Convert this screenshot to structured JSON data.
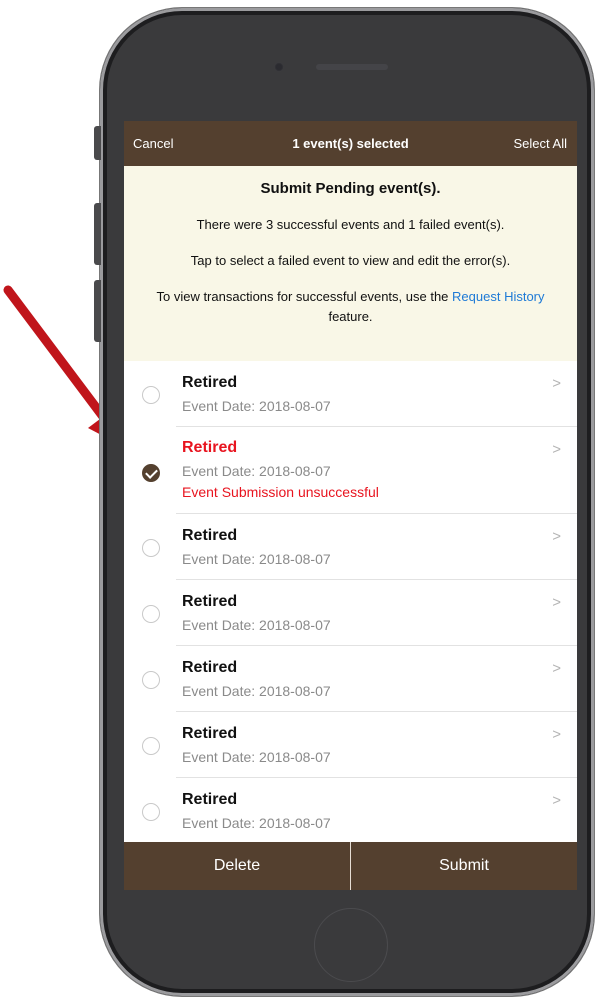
{
  "navbar": {
    "cancel_label": "Cancel",
    "title": "1 event(s) selected",
    "select_all_label": "Select All"
  },
  "banner": {
    "title": "Submit Pending event(s).",
    "line1": "There were 3 successful events and 1 failed event(s).",
    "line2": "Tap to select a failed event to view and edit the error(s).",
    "line3_prefix": "To view transactions for successful events, use the",
    "line3_link": "Request History",
    "line3_suffix": "feature."
  },
  "events": [
    {
      "title": "Retired",
      "date": "Event Date: 2018-08-07",
      "selected": false,
      "failed": false
    },
    {
      "title": "Retired",
      "date": "Event Date: 2018-08-07",
      "selected": true,
      "failed": true,
      "error": "Event Submission unsuccessful"
    },
    {
      "title": "Retired",
      "date": "Event Date: 2018-08-07",
      "selected": false,
      "failed": false
    },
    {
      "title": "Retired",
      "date": "Event Date: 2018-08-07",
      "selected": false,
      "failed": false
    },
    {
      "title": "Retired",
      "date": "Event Date: 2018-08-07",
      "selected": false,
      "failed": false
    },
    {
      "title": "Retired",
      "date": "Event Date: 2018-08-07",
      "selected": false,
      "failed": false
    },
    {
      "title": "Retired",
      "date": "Event Date: 2018-08-07",
      "selected": false,
      "failed": false
    }
  ],
  "toolbar": {
    "delete_label": "Delete",
    "submit_label": "Submit"
  },
  "icons": {
    "row_chevron": "chevron-right-icon",
    "selected_check": "checkmark-icon",
    "annotation_arrow": "red-arrow-icon"
  },
  "colors": {
    "brand_brown": "#54402f",
    "banner_bg": "#f9f7e7",
    "error_red": "#e8141f",
    "link_blue": "#1e7ad6",
    "arrow_red": "#c0151b"
  }
}
